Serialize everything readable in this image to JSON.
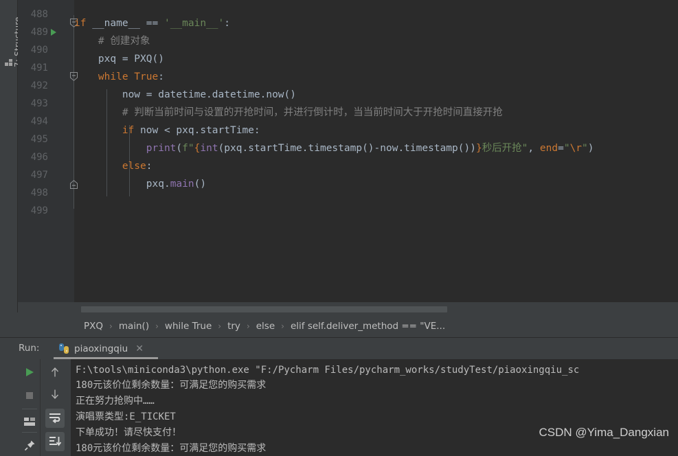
{
  "app": {
    "theme_bg": "#2b2b2b",
    "chrome_bg": "#3c3f41",
    "accent_green": "#499c54"
  },
  "left_strip": {
    "structure_tab_label": "7: Structure",
    "structure_icon": "structure-icon"
  },
  "editor": {
    "first_line_number": 488,
    "lines": [
      {
        "num": "488",
        "has_run_arrow": false,
        "fold": null
      },
      {
        "num": "489",
        "has_run_arrow": true,
        "fold": "open"
      },
      {
        "num": "490",
        "has_run_arrow": false,
        "fold": null
      },
      {
        "num": "491",
        "has_run_arrow": false,
        "fold": null
      },
      {
        "num": "492",
        "has_run_arrow": false,
        "fold": "open"
      },
      {
        "num": "493",
        "has_run_arrow": false,
        "fold": null
      },
      {
        "num": "494",
        "has_run_arrow": false,
        "fold": null
      },
      {
        "num": "495",
        "has_run_arrow": false,
        "fold": null
      },
      {
        "num": "496",
        "has_run_arrow": false,
        "fold": null
      },
      {
        "num": "497",
        "has_run_arrow": false,
        "fold": null
      },
      {
        "num": "498",
        "has_run_arrow": false,
        "fold": "end"
      },
      {
        "num": "499",
        "has_run_arrow": false,
        "fold": null
      }
    ],
    "code_text": [
      "",
      "if __name__ == '__main__':",
      "    # 创建对象",
      "    pxq = PXQ()",
      "    while True:",
      "        now = datetime.datetime.now()",
      "        # 判断当前时间与设置的开抢时间，并进行倒计时，当当前时间大于开抢时间直接开抢",
      "        if now < pxq.startTime:",
      "            print(f\"{int(pxq.startTime.timestamp()-now.timestamp())}秒后开抢\", end=\"\\r\")",
      "        else:",
      "            pxq.main()",
      ""
    ]
  },
  "breadcrumb": {
    "items": [
      "PXQ",
      "main()",
      "while True",
      "try",
      "else",
      "elif self.deliver_method == \"VE..."
    ],
    "separator": "›"
  },
  "run_window": {
    "label": "Run:",
    "tab_name": "piaoxingqiu",
    "close_label": "✕",
    "buttons": [
      {
        "name": "rerun-button",
        "icon": "play-icon"
      },
      {
        "name": "stop-button",
        "icon": "stop-icon"
      },
      {
        "name": "restore-layout-button",
        "icon": "layout-icon"
      },
      {
        "name": "pin-tab-button",
        "icon": "pin-icon"
      },
      {
        "name": "up-stack-trace-button",
        "icon": "arrow-up-icon"
      },
      {
        "name": "down-stack-trace-button",
        "icon": "arrow-down-icon"
      },
      {
        "name": "soft-wrap-button",
        "icon": "soft-wrap-icon"
      },
      {
        "name": "scroll-to-end-button",
        "icon": "scroll-to-end-icon"
      }
    ],
    "console_lines": [
      "F:\\tools\\miniconda3\\python.exe \"F:/Pycharm Files/pycharm_works/studyTest/piaoxingqiu_sc",
      "180元该价位剩余数量：可满足您的购买需求",
      "正在努力抢购中……",
      "演唱票类型:E_TICKET",
      "下单成功！请尽快支付！",
      "180元该价位剩余数量：可满足您的购买需求"
    ]
  },
  "watermark": {
    "text": "CSDN @Yima_Dangxian"
  }
}
